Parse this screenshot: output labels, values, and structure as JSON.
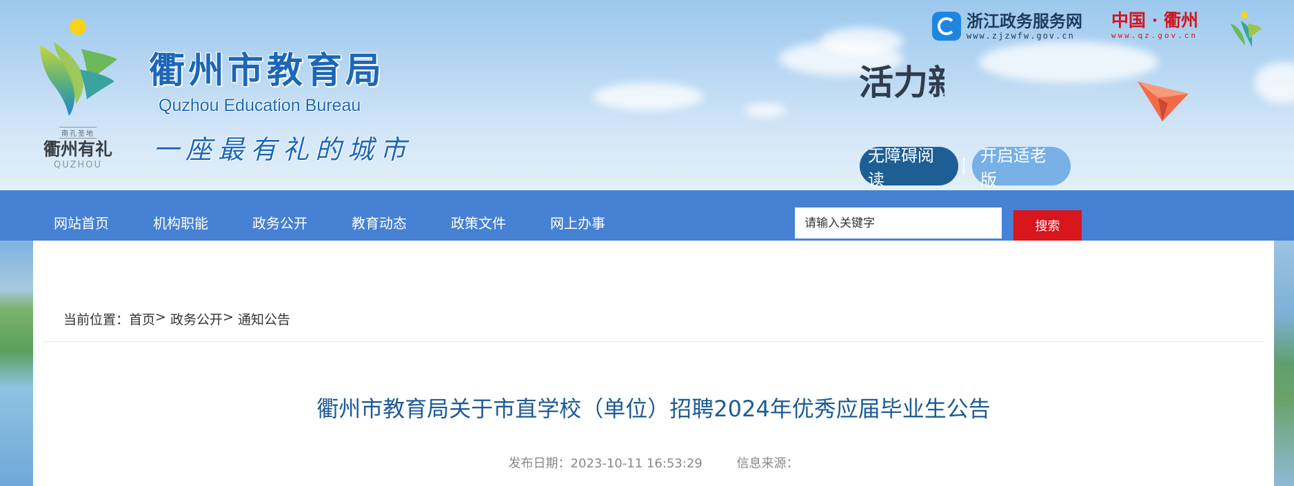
{
  "header": {
    "site_title": "衢州市教育局",
    "site_title_en": "Quzhou Education Bureau",
    "slogan": "一座最有礼的城市",
    "logo": {
      "tag": "南孔圣地",
      "cn": "衢州有礼",
      "en": "QUZHOU"
    },
    "banner_text": "活力新",
    "zjzw": {
      "name": "浙江政务服务网",
      "url": "www.zjzwfw.gov.cn"
    },
    "qz": {
      "name": "中国 · 衢州",
      "url": "www.qz.gov.cn"
    },
    "accessible_label": "无障碍阅读",
    "separator": "|",
    "elder_label": "开启适老版"
  },
  "nav": {
    "items": [
      {
        "label": "网站首页"
      },
      {
        "label": "机构职能"
      },
      {
        "label": "政务公开"
      },
      {
        "label": "教育动态"
      },
      {
        "label": "政策文件"
      },
      {
        "label": "网上办事"
      }
    ],
    "search_placeholder": "请输入关键字",
    "search_label": "搜索"
  },
  "breadcrumb": {
    "prefix": "当前位置：",
    "items": [
      "首页",
      "政务公开",
      "通知公告"
    ],
    "sep": "> "
  },
  "article": {
    "title": "衢州市教育局关于市直学校（单位）招聘2024年优秀应届毕业生公告",
    "date_label": "发布日期：",
    "date": "2023-10-11 16:53:29",
    "source_label": "信息来源："
  },
  "colors": {
    "nav": "#4681d3",
    "search_button": "#d8141d",
    "title": "#1d5a96",
    "accessible": "#1d5e94",
    "elder": "#76b0e6"
  }
}
